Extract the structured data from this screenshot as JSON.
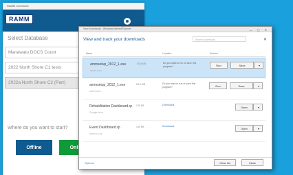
{
  "app": {
    "window_title": "RAMM Connector",
    "logo_text": "RAMM",
    "select_label": "Select Database",
    "databases": [
      "Manawatu DOCS Count",
      "2022 North Shore C1 tests",
      "2022a North Shore C2 (Part)"
    ],
    "selected_index": 2,
    "where_prompt": "Where do you want to start?",
    "offline_label": "Offline",
    "online_label": "Online",
    "colors": {
      "header": "#0f5a8f",
      "offline": "#0f5a8f",
      "online": "#0f9a3a",
      "background": "#1aa0dc"
    }
  },
  "dialog": {
    "title": "View Downloads - Windows Internet Explorer",
    "heading": "View and track your downloads",
    "search_placeholder": "Search downloads",
    "columns": {
      "name": "Name",
      "location": "Location",
      "actions": "Actions"
    },
    "rows": [
      {
        "name": "ammsetup_2012_1.exe",
        "source": "ramm.com",
        "size": "50.8 MB",
        "status": "Do you want to run or save this program?",
        "run": "Run",
        "save": "Save",
        "selected": true
      },
      {
        "name": "ammsetup_2012_1.exe",
        "source": "ramm.com",
        "size": "50.8 MB",
        "status": "Do you want to run or save this program?",
        "run": "Run",
        "save": "Save",
        "selected": false
      },
      {
        "name": "Rehabilitation Dashboard.rp",
        "source": "Google drive",
        "size": "120 KB",
        "status": "Downloads",
        "open": "Open",
        "selected": false
      },
      {
        "name": "Event Dashboard.rp",
        "source": "ramm.co.nz",
        "size": "140 KB",
        "status": "Downloads",
        "open": "Open",
        "selected": false
      }
    ],
    "options_label": "Options",
    "clear_list_label": "Clear list",
    "close_label": "Close"
  }
}
